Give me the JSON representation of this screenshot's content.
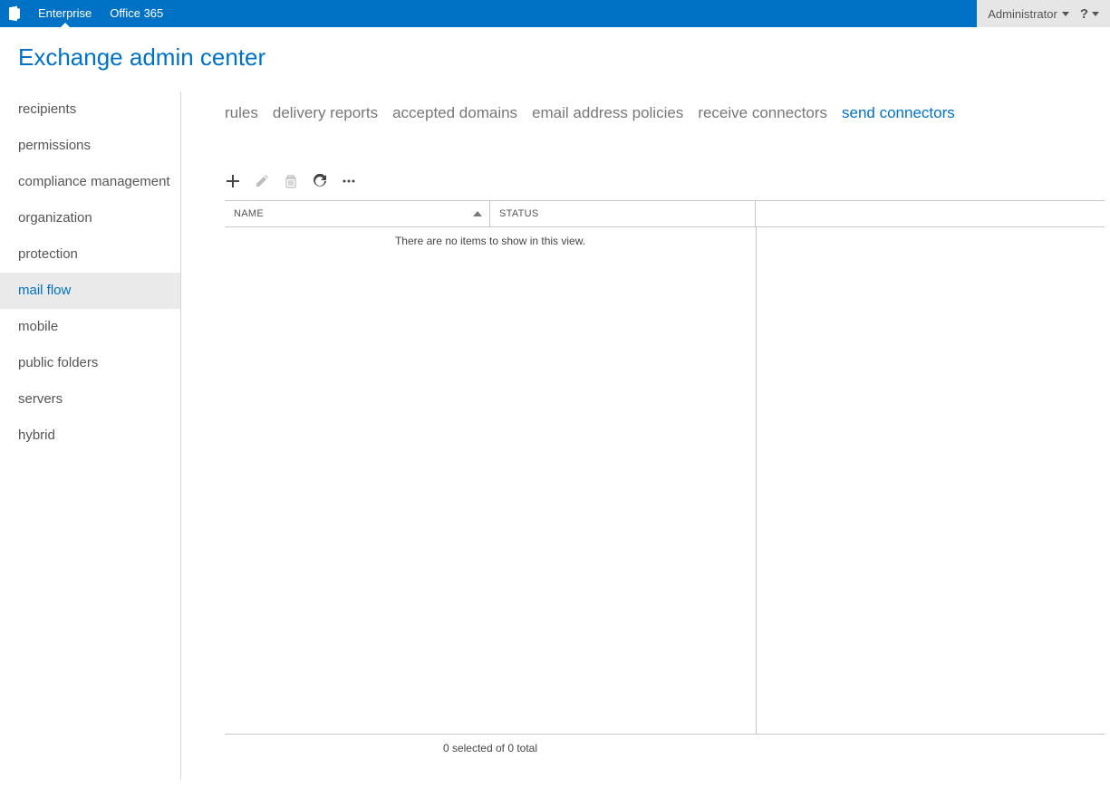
{
  "topbar": {
    "tabs": [
      {
        "label": "Enterprise",
        "active": true
      },
      {
        "label": "Office 365",
        "active": false
      }
    ],
    "user": "Administrator"
  },
  "page_title": "Exchange admin center",
  "sidebar": {
    "items": [
      {
        "label": "recipients",
        "active": false
      },
      {
        "label": "permissions",
        "active": false
      },
      {
        "label": "compliance management",
        "active": false
      },
      {
        "label": "organization",
        "active": false
      },
      {
        "label": "protection",
        "active": false
      },
      {
        "label": "mail flow",
        "active": true
      },
      {
        "label": "mobile",
        "active": false
      },
      {
        "label": "public folders",
        "active": false
      },
      {
        "label": "servers",
        "active": false
      },
      {
        "label": "hybrid",
        "active": false
      }
    ]
  },
  "tabs": [
    {
      "label": "rules",
      "active": false
    },
    {
      "label": "delivery reports",
      "active": false
    },
    {
      "label": "accepted domains",
      "active": false
    },
    {
      "label": "email address policies",
      "active": false
    },
    {
      "label": "receive connectors",
      "active": false
    },
    {
      "label": "send connectors",
      "active": true
    }
  ],
  "grid": {
    "columns": {
      "name": "NAME",
      "status": "STATUS"
    },
    "empty_message": "There are no items to show in this view.",
    "footer": "0 selected of 0 total"
  }
}
